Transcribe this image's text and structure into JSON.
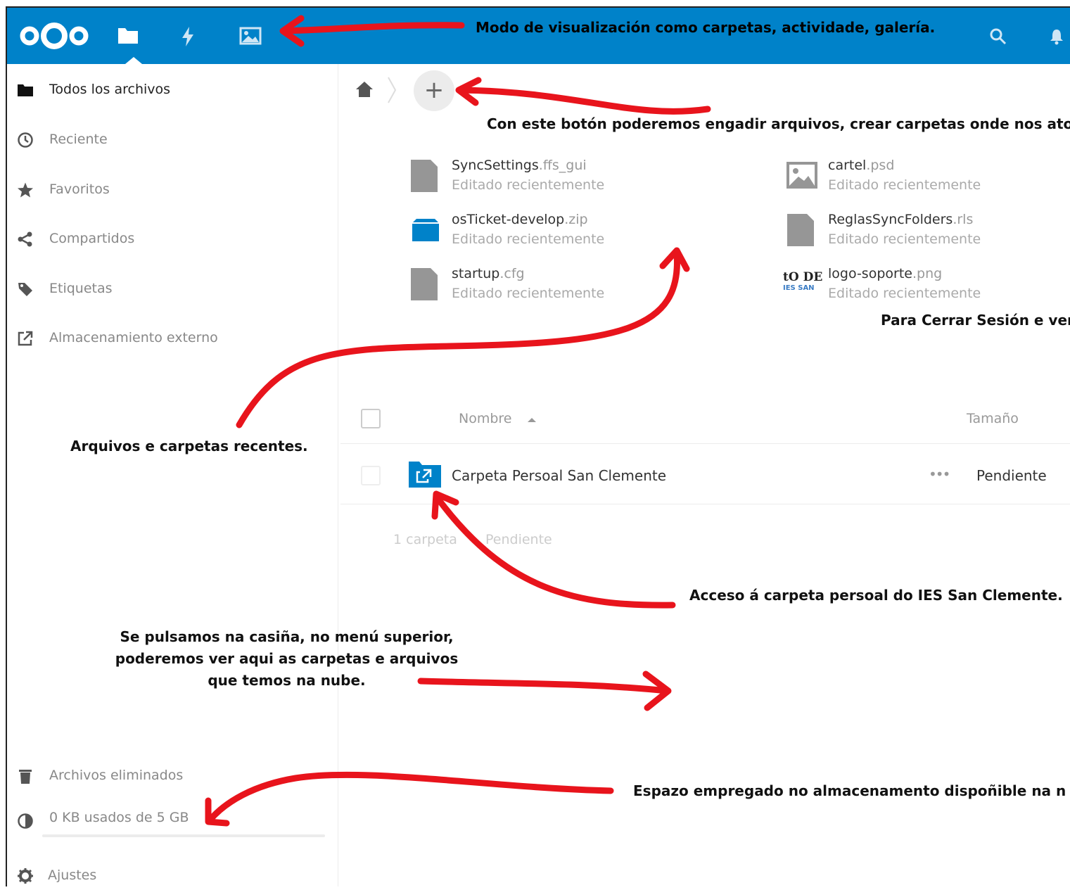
{
  "header": {
    "logo": "nextcloud-logo",
    "nav": [
      {
        "name": "files",
        "icon": "folder-icon",
        "active": true
      },
      {
        "name": "activity",
        "icon": "lightning-icon",
        "active": false
      },
      {
        "name": "gallery",
        "icon": "image-icon",
        "active": false
      }
    ],
    "color": "#0082c9"
  },
  "sidebar": {
    "items": [
      {
        "label": "Todos los archivos",
        "icon": "folder-icon"
      },
      {
        "label": "Reciente",
        "icon": "clock-icon"
      },
      {
        "label": "Favoritos",
        "icon": "star-icon"
      },
      {
        "label": "Compartidos",
        "icon": "share-icon"
      },
      {
        "label": "Etiquetas",
        "icon": "tag-icon"
      },
      {
        "label": "Almacenamiento externo",
        "icon": "external-link-icon"
      }
    ],
    "trash_label": "Archivos eliminados",
    "quota_label": "0 KB usados de 5 GB",
    "quota_used_fraction": 0,
    "settings_label": "Ajustes"
  },
  "recent": [
    {
      "base": "SyncSettings",
      "ext": ".ffs_gui",
      "sub": "Editado recientemente",
      "icon": "file-icon"
    },
    {
      "base": "cartel",
      "ext": ".psd",
      "sub": "Editado recientemente",
      "icon": "image-file-icon"
    },
    {
      "base": "osTicket-develop",
      "ext": ".zip",
      "sub": "Editado recientemente",
      "icon": "package-icon"
    },
    {
      "base": "ReglasSyncFolders",
      "ext": ".rls",
      "sub": "Editado recientemente",
      "icon": "file-icon"
    },
    {
      "base": "startup",
      "ext": ".cfg",
      "sub": "Editado recientemente",
      "icon": "file-icon"
    },
    {
      "base": "logo-soporte",
      "ext": ".png",
      "sub": "Editado recientemente",
      "icon": "thumbnail-icon"
    }
  ],
  "thumbnail": {
    "line1": "tO DE",
    "line2": "IES SAN"
  },
  "table": {
    "col_name": "Nombre",
    "col_size": "Tamaño",
    "row": {
      "name": "Carpeta Persoal San Clemente",
      "more": "•••",
      "size": "Pendiente"
    },
    "summary_count": "1 carpeta",
    "summary_size": "Pendiente"
  },
  "annotations": {
    "header": "Modo de visualización como carpetas, actividade, galería.",
    "add_button": "Con este botón poderemos engadir arquivos, crear carpetas onde nos ato",
    "logout": "Para Cerrar Sesión e ver",
    "recent": "Arquivos e carpetas recentes.",
    "personal_folder": "Acceso á carpeta persoal do IES San Clemente.",
    "home_line1": "Se pulsamos na casiña, no menú superior,",
    "home_line2": "poderemos ver aqui as carpetas e arquivos",
    "home_line3": "que temos na nube.",
    "storage": "Espazo empregado no almacenamento dispoñible na n"
  },
  "colors": {
    "accent": "#0082c9",
    "arrow": "#e8141c",
    "text": "#333333",
    "muted": "#999999"
  }
}
